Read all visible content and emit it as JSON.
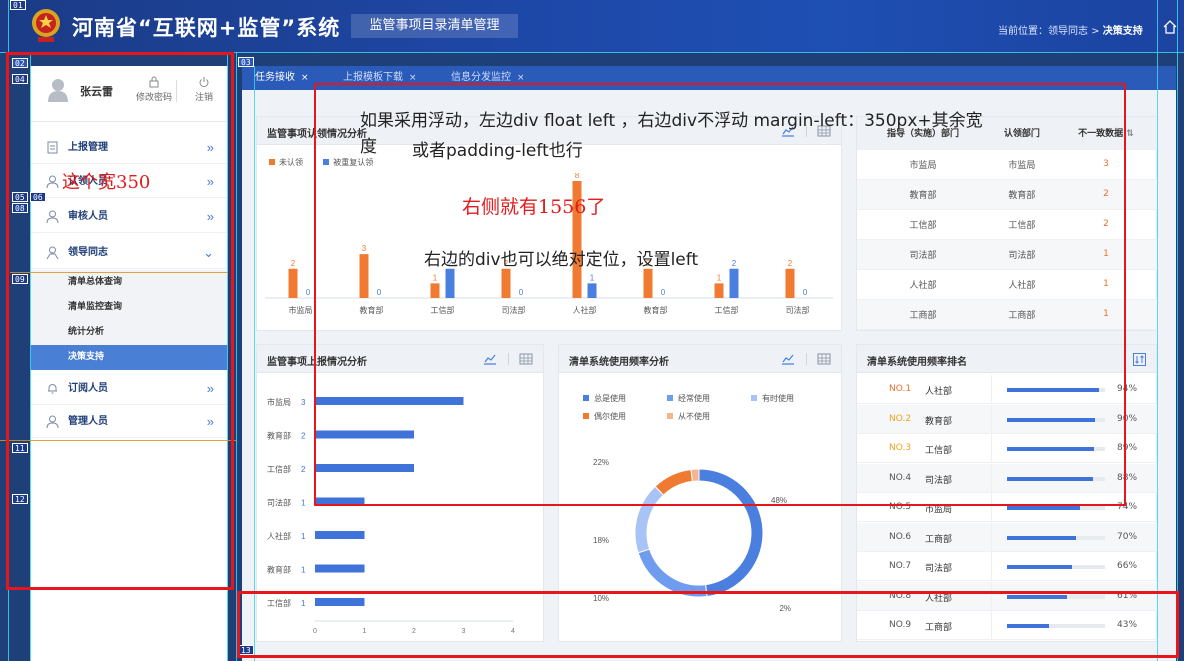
{
  "header": {
    "system_title": "河南省“互联网+监管”系统",
    "module_title": "监管事项目录清单管理",
    "breadcrumb_prefix": "当前位置：领导同志 > ",
    "breadcrumb_current": "决策支持",
    "emblem_icon": "national-emblem-icon",
    "home_icon": "home-icon"
  },
  "user": {
    "name": "张云雷",
    "change_password": "修改密码",
    "logout": "注销"
  },
  "sidebar": {
    "items": [
      {
        "label": "上报管理",
        "icon": "upload-doc-icon",
        "arrow": "»"
      },
      {
        "label": "认领人员",
        "icon": "user-icon",
        "arrow": "»"
      },
      {
        "label": "审核人员",
        "icon": "user-icon",
        "arrow": "»"
      },
      {
        "label": "领导同志",
        "icon": "leader-icon",
        "arrow": "⌄"
      },
      {
        "label": "订阅人员",
        "icon": "bell-icon",
        "arrow": "»"
      },
      {
        "label": "管理人员",
        "icon": "user-icon",
        "arrow": "»"
      }
    ],
    "sub_items": [
      "清单总体查询",
      "清单监控查询",
      "统计分析",
      "决策支持"
    ],
    "active_sub": "决策支持"
  },
  "tabs": [
    {
      "label": "任务接收",
      "close": "×",
      "active": true
    },
    {
      "label": "上报模板下载",
      "close": "×",
      "active": false
    },
    {
      "label": "信息分发监控",
      "close": "×",
      "active": false
    }
  ],
  "panels": {
    "claim": {
      "title": "监管事项认领情况分析",
      "legend": [
        "未认领",
        "被重复认领"
      ]
    },
    "dept_table": {
      "headers": [
        "指导（实施）部门",
        "认领部门",
        "不一致数据"
      ],
      "rows": [
        [
          "市监局",
          "市监局",
          "3"
        ],
        [
          "教育部",
          "教育部",
          "2"
        ],
        [
          "工信部",
          "工信部",
          "2"
        ],
        [
          "司法部",
          "司法部",
          "1"
        ],
        [
          "人社部",
          "人社部",
          "1"
        ],
        [
          "工商部",
          "工商部",
          "1"
        ]
      ]
    },
    "report": {
      "title": "监管事项上报情况分析"
    },
    "usage": {
      "title": "清单系统使用频率分析",
      "legend": [
        "总是使用",
        "经常使用",
        "有时使用",
        "偶尔使用",
        "从不使用"
      ]
    },
    "ranking": {
      "title": "清单系统使用频率排名",
      "rows": [
        {
          "no": "NO.1",
          "dept": "人社部",
          "pct": "94%",
          "value": 94
        },
        {
          "no": "NO.2",
          "dept": "教育部",
          "pct": "90%",
          "value": 90
        },
        {
          "no": "NO.3",
          "dept": "工信部",
          "pct": "89%",
          "value": 89
        },
        {
          "no": "NO.4",
          "dept": "司法部",
          "pct": "88%",
          "value": 88
        },
        {
          "no": "NO.5",
          "dept": "市监局",
          "pct": "74%",
          "value": 74
        },
        {
          "no": "NO.6",
          "dept": "工商部",
          "pct": "70%",
          "value": 70
        },
        {
          "no": "NO.7",
          "dept": "司法部",
          "pct": "66%",
          "value": 66
        },
        {
          "no": "NO.8",
          "dept": "人社部",
          "pct": "61%",
          "value": 61
        },
        {
          "no": "NO.9",
          "dept": "工商部",
          "pct": "43%",
          "value": 43
        }
      ]
    }
  },
  "annotations": {
    "width_note": "这个宽350",
    "float_note_line1": "如果采用浮动，左边div float left ，右边div不浮动 margin-left：350px+其余宽",
    "float_note_line2": "度",
    "float_note_line3": "或者padding-left也行",
    "right_note": "右侧就有1556了",
    "abs_note": "右边的div也可以绝对定位，设置left"
  },
  "markers": [
    "01",
    "02",
    "03",
    "04",
    "05",
    "06",
    "08",
    "09",
    "11",
    "12",
    "13"
  ],
  "colors": {
    "header": "#1e48a8",
    "accent": "#3f73d9",
    "orange": "#f07a32",
    "annotation_red": "#e8161b"
  },
  "chart_data": [
    {
      "type": "bar",
      "title": "监管事项认领情况分析",
      "categories": [
        "市监局",
        "教育部",
        "工信部",
        "司法部",
        "人社部",
        "教育部",
        "工信部",
        "司法部"
      ],
      "series": [
        {
          "name": "未认领",
          "values": [
            2,
            3,
            1,
            2,
            8,
            2,
            1,
            2
          ],
          "color": "#f07a32"
        },
        {
          "name": "被重复认领",
          "values": [
            0,
            0,
            2,
            0,
            1,
            0,
            2,
            0
          ],
          "color": "#4a7fe0"
        }
      ],
      "ylim": [
        0,
        8
      ]
    },
    {
      "type": "bar",
      "orientation": "horizontal",
      "title": "监管事项上报情况分析",
      "categories": [
        "市监局",
        "教育部",
        "工信部",
        "司法部",
        "人社部",
        "教育部",
        "工信部"
      ],
      "values": [
        3,
        2,
        2,
        1,
        1,
        1,
        1
      ],
      "xticks": [
        "0",
        "1",
        "2",
        "3",
        "4"
      ],
      "xlim": [
        0,
        4
      ]
    },
    {
      "type": "pie",
      "title": "清单系统使用频率分析",
      "labels": [
        "总是使用",
        "经常使用",
        "有时使用",
        "偶尔使用",
        "从不使用"
      ],
      "values": [
        48,
        22,
        18,
        10,
        2
      ],
      "data_labels": [
        "48%",
        "22%",
        "18%",
        "10%",
        "2%"
      ],
      "colors": [
        "#4a7fe0",
        "#6e9cef",
        "#a8c4f6",
        "#f07a32",
        "#f5b58e"
      ]
    }
  ]
}
